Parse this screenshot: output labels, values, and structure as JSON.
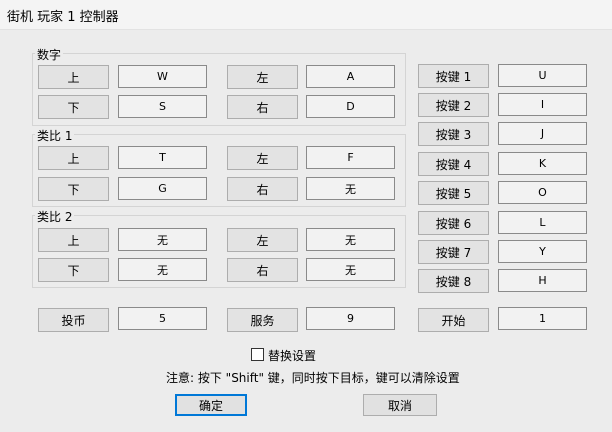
{
  "window": {
    "title": "街机 玩家 1 控制器"
  },
  "groups": {
    "digital": {
      "label": "数字"
    },
    "analog1": {
      "label": "类比 1"
    },
    "analog2": {
      "label": "类比 2"
    }
  },
  "digital": {
    "up": {
      "label": "上",
      "value": "W"
    },
    "down": {
      "label": "下",
      "value": "S"
    },
    "left": {
      "label": "左",
      "value": "A"
    },
    "right": {
      "label": "右",
      "value": "D"
    }
  },
  "analog1": {
    "up": {
      "label": "上",
      "value": "T"
    },
    "down": {
      "label": "下",
      "value": "G"
    },
    "left": {
      "label": "左",
      "value": "F"
    },
    "right": {
      "label": "右",
      "value": "无"
    }
  },
  "analog2": {
    "up": {
      "label": "上",
      "value": "无"
    },
    "down": {
      "label": "下",
      "value": "无"
    },
    "left": {
      "label": "左",
      "value": "无"
    },
    "right": {
      "label": "右",
      "value": "无"
    }
  },
  "keys": [
    {
      "label": "按键 1",
      "value": "U"
    },
    {
      "label": "按键 2",
      "value": "I"
    },
    {
      "label": "按键 3",
      "value": "J"
    },
    {
      "label": "按键 4",
      "value": "K"
    },
    {
      "label": "按键 5",
      "value": "O"
    },
    {
      "label": "按键 6",
      "value": "L"
    },
    {
      "label": "按键 7",
      "value": "Y"
    },
    {
      "label": "按键 8",
      "value": "H"
    }
  ],
  "bottom": {
    "coin": {
      "label": "投币",
      "value": "5"
    },
    "service": {
      "label": "服务",
      "value": "9"
    },
    "start": {
      "label": "开始",
      "value": "1"
    }
  },
  "replace_checkbox": {
    "label": "替换设置",
    "checked": false
  },
  "note": "注意: 按下 \"Shift\" 键，同时按下目标，键可以清除设置",
  "buttons": {
    "ok": "确定",
    "cancel": "取消"
  }
}
